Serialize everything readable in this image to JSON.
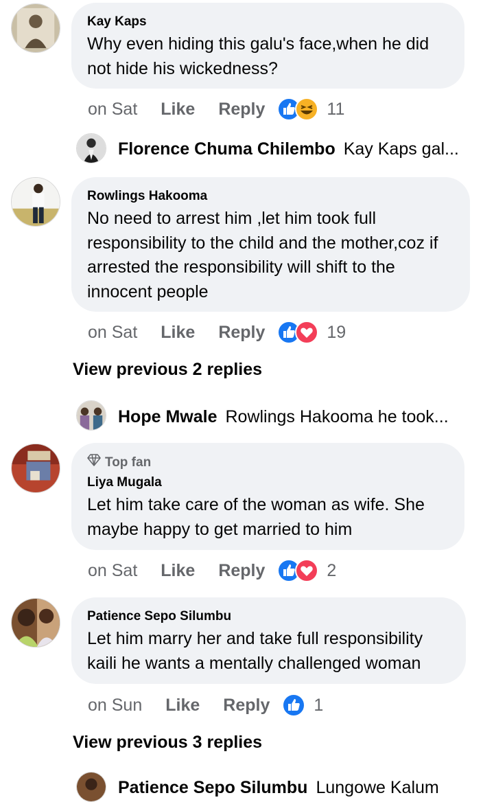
{
  "comments": [
    {
      "author": "Kay Kaps",
      "text": "Why even hiding this galu's face,when he did not hide his wickedness?",
      "time": "on Sat",
      "like_label": "Like",
      "reply_label": "Reply",
      "reactions": [
        "like",
        "haha"
      ],
      "reaction_count": "11"
    },
    {
      "author": "Rowlings Hakooma",
      "text": "No need to arrest him ,let him took full responsibility to the child and the mother,coz if arrested the responsibility will shift to the innocent people",
      "time": "on Sat",
      "like_label": "Like",
      "reply_label": "Reply",
      "reactions": [
        "like",
        "love"
      ],
      "reaction_count": "19"
    },
    {
      "badge": "Top fan",
      "author": "Liya Mugala",
      "text": "Let him take care of the woman as wife. She maybe happy to get married to him",
      "time": "on Sat",
      "like_label": "Like",
      "reply_label": "Reply",
      "reactions": [
        "like",
        "love"
      ],
      "reaction_count": "2"
    },
    {
      "author": "Patience Sepo Silumbu",
      "text": "Let him marry her and take full responsibility kaili he wants a mentally challenged woman",
      "time": "on Sun",
      "like_label": "Like",
      "reply_label": "Reply",
      "reactions": [
        "like"
      ],
      "reaction_count": "1"
    }
  ],
  "replies": [
    {
      "author": "Florence Chuma Chilembo",
      "text": "Kay Kaps gal..."
    },
    {
      "author": "Hope Mwale",
      "text": "Rowlings Hakooma he took..."
    },
    {
      "author": "Patience Sepo Silumbu",
      "text": "Lungowe Kalum"
    }
  ],
  "view_previous": [
    "View previous 2 replies",
    "View previous 3 replies"
  ],
  "colors": {
    "bubble": "#f0f2f5",
    "like_blue": "#1877f2",
    "love_red": "#f33e58",
    "haha_yellow": "#f7b125",
    "muted": "#65676b"
  }
}
